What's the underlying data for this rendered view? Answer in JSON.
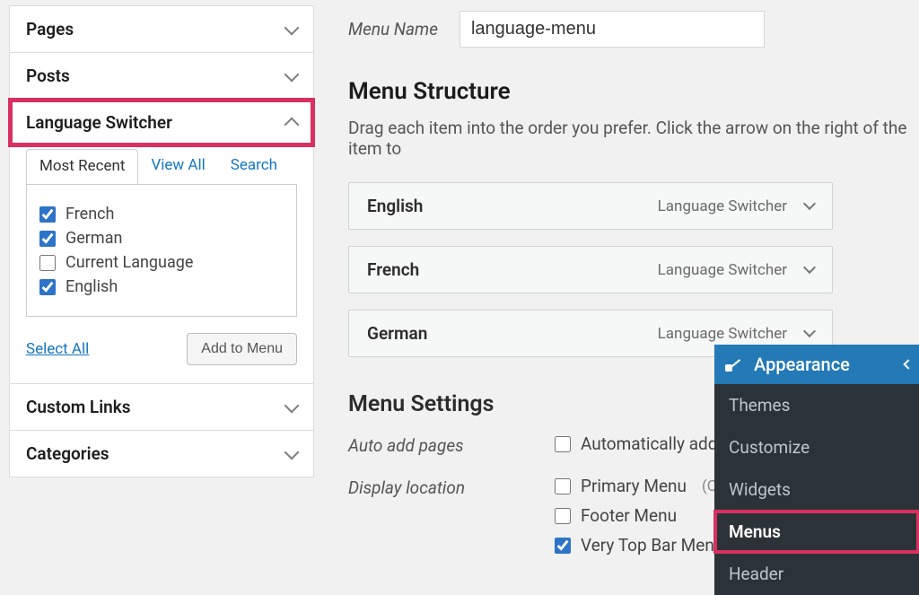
{
  "sidebar": {
    "pages": "Pages",
    "posts": "Posts",
    "lang_switcher": "Language Switcher",
    "custom_links": "Custom Links",
    "categories": "Categories",
    "tabs": {
      "recent": "Most Recent",
      "view_all": "View All",
      "search": "Search"
    },
    "items": {
      "french": {
        "label": "French",
        "checked": true
      },
      "german": {
        "label": "German",
        "checked": true
      },
      "current": {
        "label": "Current Language",
        "checked": false
      },
      "english": {
        "label": "English",
        "checked": true
      }
    },
    "select_all": "Select All",
    "add_to_menu": "Add to Menu"
  },
  "menu_name": {
    "label": "Menu Name",
    "value": "language-menu"
  },
  "structure": {
    "title": "Menu Structure",
    "instruction": "Drag each item into the order you prefer. Click the arrow on the right of the item to",
    "type_label": "Language Switcher",
    "items": [
      {
        "title": "English"
      },
      {
        "title": "French"
      },
      {
        "title": "German"
      }
    ]
  },
  "settings": {
    "title": "Menu Settings",
    "auto_add": {
      "label": "Auto add pages",
      "opt": {
        "text": "Automatically add n",
        "checked": false
      }
    },
    "display_loc": {
      "label": "Display location",
      "primary": {
        "text": "Primary Menu",
        "sub": "(Curre",
        "checked": false
      },
      "footer": {
        "text": "Footer Menu",
        "checked": false
      },
      "very_top": {
        "text": "Very Top Bar Menu",
        "checked": true
      }
    }
  },
  "flyout": {
    "title": "Appearance",
    "items": {
      "themes": "Themes",
      "customize": "Customize",
      "widgets": "Widgets",
      "menus": "Menus",
      "header": "Header"
    }
  }
}
